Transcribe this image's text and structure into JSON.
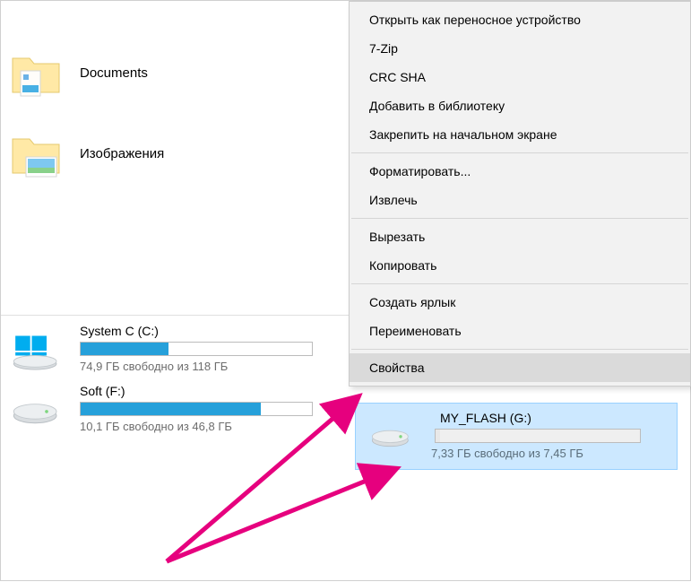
{
  "folders": [
    {
      "label": "Documents",
      "icon": "documents"
    },
    {
      "label": "Изображения",
      "icon": "pictures"
    }
  ],
  "drives": [
    {
      "name": "System C (C:)",
      "status": "74,9 ГБ свободно из 118 ГБ",
      "fill": 38,
      "type": "system"
    },
    {
      "name": "Soft (F:)",
      "status": "10,1 ГБ свободно из 46,8 ГБ",
      "fill": 78,
      "type": "hdd"
    }
  ],
  "selected_drive": {
    "name": "MY_FLASH (G:)",
    "status": "7,33 ГБ свободно из 7,45 ГБ",
    "fill": 2
  },
  "context_menu": {
    "group1": [
      "Открыть как переносное устройство",
      "7-Zip",
      "CRC SHA",
      "Добавить в библиотеку",
      "Закрепить на начальном экране"
    ],
    "group2": [
      "Форматировать...",
      "Извлечь"
    ],
    "group3": [
      "Вырезать",
      "Копировать"
    ],
    "group4": [
      "Создать ярлык",
      "Переименовать"
    ],
    "highlighted": "Свойства"
  }
}
